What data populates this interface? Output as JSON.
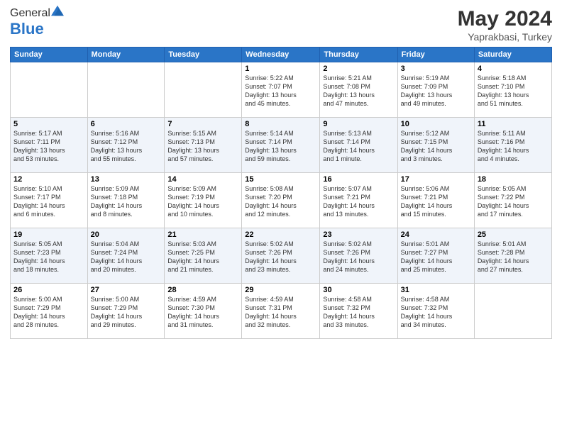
{
  "logo": {
    "general": "General",
    "blue": "Blue"
  },
  "title": {
    "month": "May 2024",
    "location": "Yaprakbasi, Turkey"
  },
  "weekdays": [
    "Sunday",
    "Monday",
    "Tuesday",
    "Wednesday",
    "Thursday",
    "Friday",
    "Saturday"
  ],
  "weeks": [
    [
      {
        "day": "",
        "info": ""
      },
      {
        "day": "",
        "info": ""
      },
      {
        "day": "",
        "info": ""
      },
      {
        "day": "1",
        "info": "Sunrise: 5:22 AM\nSunset: 7:07 PM\nDaylight: 13 hours\nand 45 minutes."
      },
      {
        "day": "2",
        "info": "Sunrise: 5:21 AM\nSunset: 7:08 PM\nDaylight: 13 hours\nand 47 minutes."
      },
      {
        "day": "3",
        "info": "Sunrise: 5:19 AM\nSunset: 7:09 PM\nDaylight: 13 hours\nand 49 minutes."
      },
      {
        "day": "4",
        "info": "Sunrise: 5:18 AM\nSunset: 7:10 PM\nDaylight: 13 hours\nand 51 minutes."
      }
    ],
    [
      {
        "day": "5",
        "info": "Sunrise: 5:17 AM\nSunset: 7:11 PM\nDaylight: 13 hours\nand 53 minutes."
      },
      {
        "day": "6",
        "info": "Sunrise: 5:16 AM\nSunset: 7:12 PM\nDaylight: 13 hours\nand 55 minutes."
      },
      {
        "day": "7",
        "info": "Sunrise: 5:15 AM\nSunset: 7:13 PM\nDaylight: 13 hours\nand 57 minutes."
      },
      {
        "day": "8",
        "info": "Sunrise: 5:14 AM\nSunset: 7:14 PM\nDaylight: 13 hours\nand 59 minutes."
      },
      {
        "day": "9",
        "info": "Sunrise: 5:13 AM\nSunset: 7:14 PM\nDaylight: 14 hours\nand 1 minute."
      },
      {
        "day": "10",
        "info": "Sunrise: 5:12 AM\nSunset: 7:15 PM\nDaylight: 14 hours\nand 3 minutes."
      },
      {
        "day": "11",
        "info": "Sunrise: 5:11 AM\nSunset: 7:16 PM\nDaylight: 14 hours\nand 4 minutes."
      }
    ],
    [
      {
        "day": "12",
        "info": "Sunrise: 5:10 AM\nSunset: 7:17 PM\nDaylight: 14 hours\nand 6 minutes."
      },
      {
        "day": "13",
        "info": "Sunrise: 5:09 AM\nSunset: 7:18 PM\nDaylight: 14 hours\nand 8 minutes."
      },
      {
        "day": "14",
        "info": "Sunrise: 5:09 AM\nSunset: 7:19 PM\nDaylight: 14 hours\nand 10 minutes."
      },
      {
        "day": "15",
        "info": "Sunrise: 5:08 AM\nSunset: 7:20 PM\nDaylight: 14 hours\nand 12 minutes."
      },
      {
        "day": "16",
        "info": "Sunrise: 5:07 AM\nSunset: 7:21 PM\nDaylight: 14 hours\nand 13 minutes."
      },
      {
        "day": "17",
        "info": "Sunrise: 5:06 AM\nSunset: 7:21 PM\nDaylight: 14 hours\nand 15 minutes."
      },
      {
        "day": "18",
        "info": "Sunrise: 5:05 AM\nSunset: 7:22 PM\nDaylight: 14 hours\nand 17 minutes."
      }
    ],
    [
      {
        "day": "19",
        "info": "Sunrise: 5:05 AM\nSunset: 7:23 PM\nDaylight: 14 hours\nand 18 minutes."
      },
      {
        "day": "20",
        "info": "Sunrise: 5:04 AM\nSunset: 7:24 PM\nDaylight: 14 hours\nand 20 minutes."
      },
      {
        "day": "21",
        "info": "Sunrise: 5:03 AM\nSunset: 7:25 PM\nDaylight: 14 hours\nand 21 minutes."
      },
      {
        "day": "22",
        "info": "Sunrise: 5:02 AM\nSunset: 7:26 PM\nDaylight: 14 hours\nand 23 minutes."
      },
      {
        "day": "23",
        "info": "Sunrise: 5:02 AM\nSunset: 7:26 PM\nDaylight: 14 hours\nand 24 minutes."
      },
      {
        "day": "24",
        "info": "Sunrise: 5:01 AM\nSunset: 7:27 PM\nDaylight: 14 hours\nand 25 minutes."
      },
      {
        "day": "25",
        "info": "Sunrise: 5:01 AM\nSunset: 7:28 PM\nDaylight: 14 hours\nand 27 minutes."
      }
    ],
    [
      {
        "day": "26",
        "info": "Sunrise: 5:00 AM\nSunset: 7:29 PM\nDaylight: 14 hours\nand 28 minutes."
      },
      {
        "day": "27",
        "info": "Sunrise: 5:00 AM\nSunset: 7:29 PM\nDaylight: 14 hours\nand 29 minutes."
      },
      {
        "day": "28",
        "info": "Sunrise: 4:59 AM\nSunset: 7:30 PM\nDaylight: 14 hours\nand 31 minutes."
      },
      {
        "day": "29",
        "info": "Sunrise: 4:59 AM\nSunset: 7:31 PM\nDaylight: 14 hours\nand 32 minutes."
      },
      {
        "day": "30",
        "info": "Sunrise: 4:58 AM\nSunset: 7:32 PM\nDaylight: 14 hours\nand 33 minutes."
      },
      {
        "day": "31",
        "info": "Sunrise: 4:58 AM\nSunset: 7:32 PM\nDaylight: 14 hours\nand 34 minutes."
      },
      {
        "day": "",
        "info": ""
      }
    ]
  ]
}
